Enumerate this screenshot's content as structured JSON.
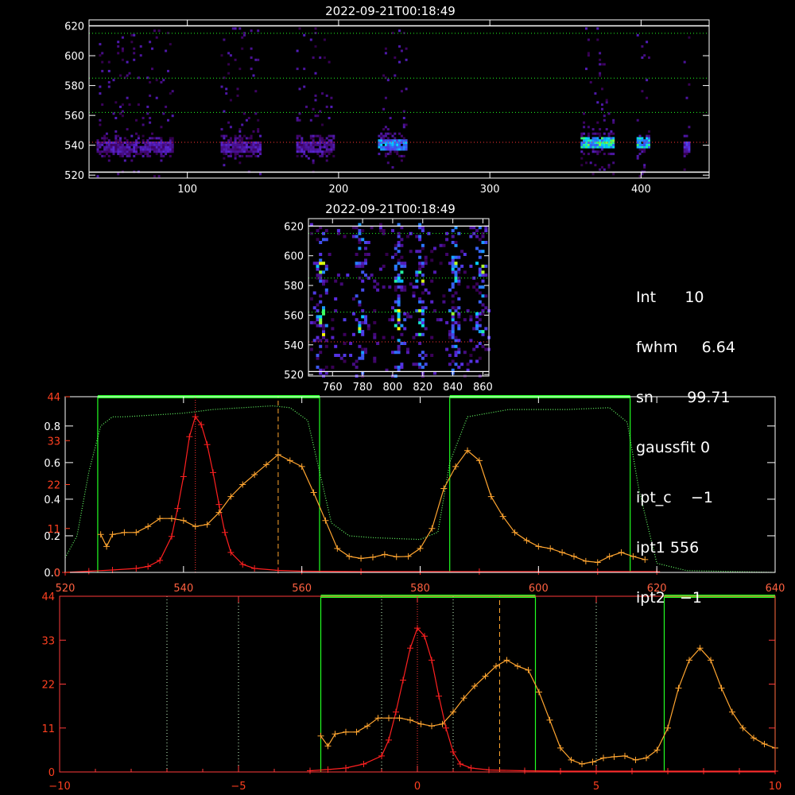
{
  "chart_data": [
    {
      "type": "heatmap",
      "title": "2022-09-21T00:18:49",
      "xlim": [
        35,
        445
      ],
      "ylim": [
        518,
        624
      ],
      "x_ticks": [
        100,
        200,
        300,
        400
      ],
      "y_ticks": [
        520,
        540,
        560,
        580,
        600,
        620
      ],
      "hlines_solid": [
        522,
        620
      ],
      "hlines_green": [
        562,
        585,
        615
      ],
      "hlines_red": [
        542
      ],
      "blobs": [
        {
          "x": [
            40,
            90
          ],
          "y": 540,
          "i": 0.35
        },
        {
          "x": [
            122,
            148
          ],
          "y": 540,
          "i": 0.35
        },
        {
          "x": [
            172,
            196
          ],
          "y": 540,
          "i": 0.35
        },
        {
          "x": [
            226,
            244
          ],
          "y": 541,
          "i": 0.7
        },
        {
          "x": [
            360,
            382
          ],
          "y": 542,
          "i": 0.85
        },
        {
          "x": [
            397,
            405
          ],
          "y": 542,
          "i": 0.8
        },
        {
          "x": [
            428,
            432
          ],
          "y": 540,
          "i": 0.45
        }
      ]
    },
    {
      "type": "heatmap",
      "title": "2022-09-21T00:18:49",
      "xlim": [
        744,
        864
      ],
      "ylim": [
        519,
        625
      ],
      "x_ticks": [
        760,
        780,
        800,
        820,
        840,
        860
      ],
      "y_ticks": [
        520,
        540,
        560,
        580,
        600,
        620
      ],
      "hlines_solid": [
        522,
        620
      ],
      "hlines_green": [
        562,
        585,
        615
      ],
      "hlines_red": [
        542
      ],
      "columns": [
        752,
        778,
        803,
        818,
        840,
        858
      ]
    },
    {
      "type": "line",
      "xlim": [
        520,
        640
      ],
      "x_ticks": [
        520,
        540,
        560,
        580,
        600,
        620,
        640
      ],
      "y_left_ticks": [
        0.0,
        0.2,
        0.4,
        0.6,
        0.8
      ],
      "y_left_tick_labels": [
        "0.0",
        "0.2",
        "0.4",
        "0.6",
        "0.8"
      ],
      "y_left_ticks_lim": [
        0,
        0.96
      ],
      "y_red_ticks_labels": [
        "0",
        "11",
        "22",
        "33",
        "44"
      ],
      "y_red_lim": [
        0,
        44
      ],
      "green_boxes": [
        [
          525.5,
          563
        ],
        [
          585,
          615.5
        ]
      ],
      "vline_red_dotted": 542,
      "vline_orange_dashed": 556,
      "red_series": {
        "x": [
          520,
          524,
          528,
          532,
          534,
          536,
          538,
          539,
          540,
          541,
          542,
          543,
          544,
          545,
          546,
          547,
          548,
          550,
          552,
          556,
          560,
          570,
          580,
          590,
          600,
          610,
          620
        ],
        "y": [
          0,
          0.3,
          0.6,
          1,
          1.5,
          3,
          9,
          16,
          24,
          34,
          39,
          37,
          32,
          25,
          17,
          10,
          5,
          2,
          1,
          0.5,
          0.3,
          0.2,
          0.2,
          0.2,
          0.2,
          0.2,
          0.2
        ]
      },
      "orange_series": {
        "x": [
          526,
          527,
          528,
          530,
          532,
          534,
          536,
          538,
          540,
          542,
          544,
          546,
          548,
          550,
          552,
          554,
          556,
          558,
          560,
          562,
          564,
          566,
          568,
          570,
          572,
          574,
          576,
          578,
          580,
          582,
          584,
          586,
          588,
          590,
          592,
          594,
          596,
          598,
          600,
          602,
          604,
          606,
          608,
          610,
          612,
          614,
          616,
          618
        ],
        "y": [
          9.5,
          6.5,
          9.5,
          10,
          10,
          11.5,
          13.5,
          13.5,
          13,
          11.5,
          12,
          15,
          19,
          22,
          24.5,
          27,
          29.5,
          28,
          26.5,
          20,
          13,
          6,
          4,
          3.5,
          3.8,
          4.5,
          3.9,
          4,
          6,
          11,
          21,
          26.5,
          30.5,
          28,
          19,
          14,
          10,
          8,
          6.5,
          6,
          5,
          4,
          2.8,
          2.5,
          4,
          5,
          4,
          3.2
        ]
      },
      "green_series": {
        "x": [
          520,
          522,
          524,
          526,
          528,
          530,
          535,
          540,
          545,
          550,
          555,
          558,
          561,
          563,
          565,
          568,
          572,
          580,
          583,
          585,
          588,
          595,
          605,
          612,
          615,
          617,
          620,
          625,
          640
        ],
        "y": [
          0.08,
          0.2,
          0.55,
          0.8,
          0.85,
          0.85,
          0.86,
          0.87,
          0.89,
          0.9,
          0.91,
          0.9,
          0.83,
          0.55,
          0.27,
          0.2,
          0.19,
          0.18,
          0.22,
          0.6,
          0.85,
          0.89,
          0.89,
          0.9,
          0.82,
          0.45,
          0.05,
          0.01,
          0.0
        ]
      }
    },
    {
      "type": "line",
      "xlim": [
        -10,
        10
      ],
      "x_ticks": [
        -10,
        -5,
        0,
        5,
        10
      ],
      "y_tick_labels": [
        "0",
        "11",
        "22",
        "33",
        "44"
      ],
      "ylim": [
        0,
        44
      ],
      "green_boxes": [
        [
          -2.7,
          3.3
        ],
        [
          6.9,
          10
        ]
      ],
      "vlines_green_dotted": [
        -7,
        -5,
        -1,
        1,
        5
      ],
      "vline_red_dotted": 0,
      "vline_orange_dashed": 2.3,
      "red_series": {
        "x": [
          -3,
          -2.5,
          -2,
          -1.5,
          -1,
          -0.8,
          -0.6,
          -0.4,
          -0.2,
          0,
          0.2,
          0.4,
          0.6,
          0.8,
          1,
          1.2,
          1.5,
          2,
          3,
          4,
          5,
          6,
          7,
          8,
          9,
          10
        ],
        "y": [
          0.3,
          0.6,
          1,
          2,
          4,
          8,
          15,
          23,
          31,
          36,
          34,
          28,
          19,
          11,
          5,
          2,
          1,
          0.5,
          0.3,
          0.2,
          0.2,
          0.2,
          0.2,
          0.2,
          0.2,
          0.2
        ]
      },
      "orange_series": {
        "x": [
          -2.7,
          -2.5,
          -2.3,
          -2,
          -1.7,
          -1.4,
          -1.1,
          -0.8,
          -0.5,
          -0.2,
          0.1,
          0.4,
          0.7,
          1.0,
          1.3,
          1.6,
          1.9,
          2.2,
          2.5,
          2.8,
          3.1,
          3.4,
          3.7,
          4.0,
          4.3,
          4.6,
          4.9,
          5.2,
          5.5,
          5.8,
          6.1,
          6.4,
          6.7,
          7.0,
          7.3,
          7.6,
          7.9,
          8.2,
          8.5,
          8.8,
          9.1,
          9.4,
          9.7,
          10
        ],
        "y": [
          9,
          6.5,
          9.5,
          10,
          10,
          11.5,
          13.5,
          13.5,
          13.5,
          13,
          12,
          11.5,
          12,
          15,
          18.5,
          21.5,
          24,
          26.5,
          28,
          26.5,
          25.5,
          20,
          13,
          6,
          3,
          2,
          2.5,
          3.5,
          3.8,
          4,
          3,
          3.5,
          5.5,
          11,
          21,
          28,
          31,
          28,
          21,
          15,
          11,
          8.5,
          7,
          6
        ]
      }
    }
  ]
}
